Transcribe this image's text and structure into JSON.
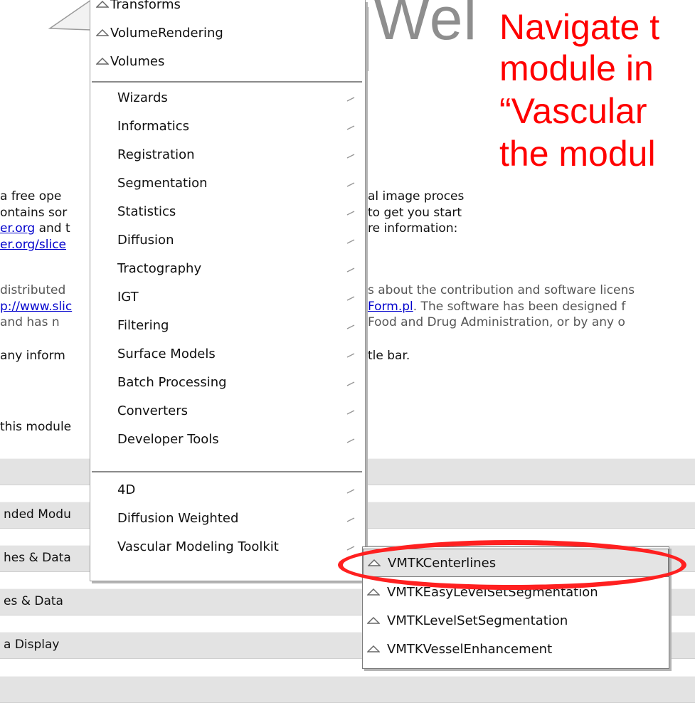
{
  "background": {
    "welcome_fragment": "Wel",
    "left_fragments": [
      {
        "text": "a free ope",
        "link": false
      },
      {
        "text": "ontains sor",
        "link": false
      },
      {
        "text": "er.org",
        "link": true,
        "suffix": " and t"
      },
      {
        "text": "er.org/slice",
        "link": true
      }
    ],
    "right_fragments": [
      "al image proces",
      "to get you start",
      "re information:"
    ],
    "license_left": [
      "distributed",
      "p://www.slic",
      "and has n"
    ],
    "license_right": {
      "line1": "s about the contribution and software licens",
      "line2_link": "Form.pl",
      "line2_rest": ". The software has been designed f",
      "line3": "Food and Drug Administration, or by any o"
    },
    "info_left": "any inform",
    "info_right": "tle bar.",
    "this_module": "this module"
  },
  "panels": [
    {
      "label": ""
    },
    {
      "label": "nded Modu"
    },
    {
      "label": "hes & Data"
    },
    {
      "label": "es & Data"
    },
    {
      "label": "a Display"
    }
  ],
  "annotation": {
    "lines": [
      "Navigate t",
      "module in",
      "“Vascular",
      "the modul"
    ],
    "color": "#ff0000"
  },
  "menu": {
    "top_items": [
      {
        "label": "Transforms"
      },
      {
        "label": "VolumeRendering"
      },
      {
        "label": "Volumes"
      }
    ],
    "categories": [
      {
        "label": "Wizards"
      },
      {
        "label": "Informatics"
      },
      {
        "label": "Registration"
      },
      {
        "label": "Segmentation"
      },
      {
        "label": "Statistics"
      },
      {
        "label": "Diffusion"
      },
      {
        "label": "Tractography"
      },
      {
        "label": "IGT"
      },
      {
        "label": "Filtering"
      },
      {
        "label": "Surface Models"
      },
      {
        "label": "Batch Processing"
      },
      {
        "label": "Converters"
      },
      {
        "label": "Developer Tools"
      }
    ],
    "extensions": [
      {
        "label": "4D"
      },
      {
        "label": "Diffusion Weighted"
      },
      {
        "label": "Vascular Modeling Toolkit"
      }
    ]
  },
  "submenu": {
    "items": [
      {
        "label": "VMTKCenterlines",
        "highlighted": true
      },
      {
        "label": "VMTKEasyLevelSetSegmentation",
        "highlighted": false
      },
      {
        "label": "VMTKLevelSetSegmentation",
        "highlighted": false
      },
      {
        "label": "VMTKVesselEnhancement",
        "highlighted": false
      }
    ]
  },
  "icons": {
    "module_icon": "diamond-icon",
    "submenu_arrow": "submenu-arrow-icon",
    "highlight_color": "#ff2020"
  }
}
